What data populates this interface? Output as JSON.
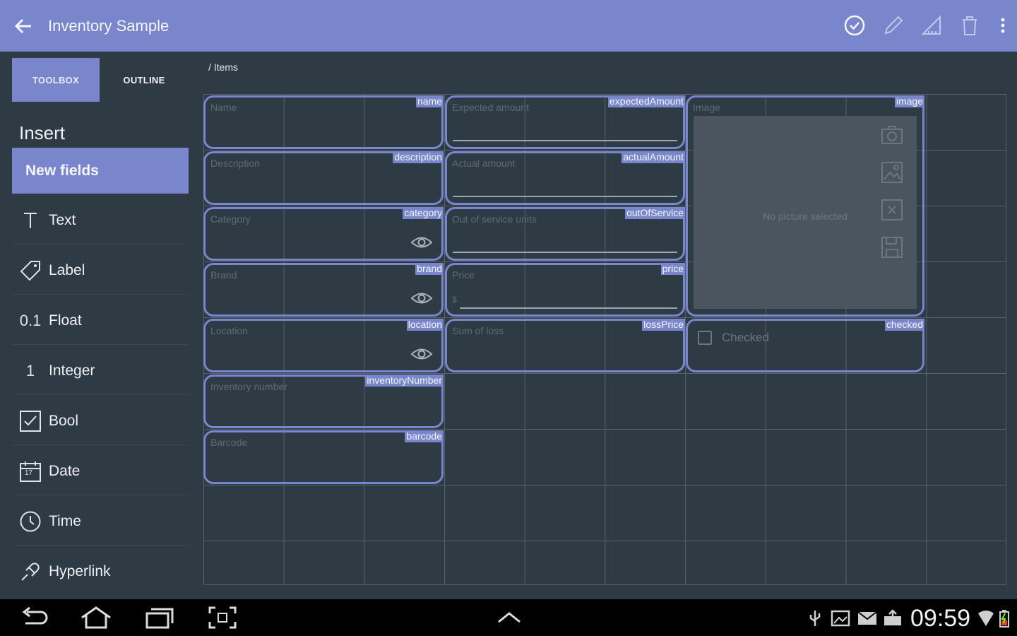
{
  "appbar": {
    "title": "Inventory Sample",
    "actions": [
      "check-circle-icon",
      "pencil-icon",
      "ruler-icon",
      "trash-icon",
      "more-vert-icon"
    ]
  },
  "tabs": {
    "toolbox": "TOOLBOX",
    "outline": "OUTLINE"
  },
  "sidebar": {
    "heading": "Insert",
    "section": "New fields",
    "items": [
      {
        "label": "Text",
        "icon": "text-icon"
      },
      {
        "label": "Label",
        "icon": "label-tag-icon"
      },
      {
        "label": "Float",
        "icon": "float-icon",
        "icon_text": "0.1"
      },
      {
        "label": "Integer",
        "icon": "integer-icon",
        "icon_text": "1"
      },
      {
        "label": "Bool",
        "icon": "checkbox-icon"
      },
      {
        "label": "Date",
        "icon": "calendar-icon",
        "icon_text": "17"
      },
      {
        "label": "Time",
        "icon": "clock-icon"
      },
      {
        "label": "Hyperlink",
        "icon": "link-icon"
      }
    ]
  },
  "breadcrumb": "/ Items",
  "fields": {
    "name": {
      "placeholder": "Name",
      "tag": "name"
    },
    "description": {
      "placeholder": "Description",
      "tag": "description"
    },
    "category": {
      "placeholder": "Category",
      "tag": "category"
    },
    "brand": {
      "placeholder": "Brand",
      "tag": "brand"
    },
    "location": {
      "placeholder": "Location",
      "tag": "location"
    },
    "inventory_number": {
      "placeholder": "Inventory number",
      "tag": "inventoryNumber"
    },
    "barcode": {
      "placeholder": "Barcode",
      "tag": "barcode"
    },
    "expected_amount": {
      "placeholder": "Expected amount",
      "tag": "expectedAmount"
    },
    "actual_amount": {
      "placeholder": "Actual amount",
      "tag": "actualAmount"
    },
    "out_of_service": {
      "placeholder": "Out of service units",
      "tag": "outOfService"
    },
    "price": {
      "placeholder": "Price",
      "tag": "price",
      "prefix": "$"
    },
    "sum_of_loss": {
      "placeholder": "Sum of loss",
      "tag": "lossPrice"
    },
    "image": {
      "placeholder": "Image",
      "tag": "image",
      "empty_text": "No picture selected"
    },
    "checked": {
      "label": "Checked",
      "tag": "checked"
    }
  },
  "status_bar": {
    "time": "09:59",
    "icons": [
      "usb-icon",
      "gallery-icon",
      "mail-icon",
      "upload-icon",
      "wifi-icon",
      "battery-icon"
    ]
  },
  "colors": {
    "accent": "#7986cb",
    "background": "#2e3a44",
    "navbar": "#000000"
  }
}
